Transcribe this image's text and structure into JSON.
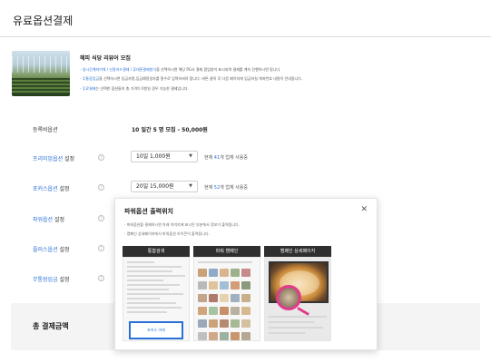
{
  "page": {
    "title": "유료옵션결제"
  },
  "banner": {
    "heading": "헤피 식당 리뷰어 모집",
    "notes": [
      {
        "highlight": "- 실시간계좌이체 / 신용카드결제 / 휴대폰결제방식",
        "text": "을 선택하시면 해당 PG사 결제 팝업창이 표시되며 결제를 계속 진행하시면 됩니다."
      },
      {
        "highlight": "- 무통장입금",
        "text": "을 선택하시면 입금자명,입금예정일자를 필수로 입력하셔야 합니다. 버튼 클릭 후 다음 페이지에 입금하실 계좌번호 내용이 안내됩니다."
      },
      {
        "highlight": "- 무료결제",
        "text": "는 선택한 옵션들의 총 가격이 0원일 경우 가능한 결제입니다."
      }
    ]
  },
  "rows": {
    "registration": {
      "label": "등록비옵션",
      "value": "10 일간 5 명 모집 - 50,000원"
    },
    "premium": {
      "label_hl": "프리미엄옵션",
      "label_rest": " 설정",
      "select": "10일 1,000원",
      "usage_pre": "현재 ",
      "usage_count": "41",
      "usage_post": "개 업체 사용중"
    },
    "focus": {
      "label_hl": "포커스옵션",
      "label_rest": " 설정",
      "select": "20일 15,000원",
      "usage_pre": "현재 ",
      "usage_count": "52",
      "usage_post": "개 업체 사용중"
    },
    "power": {
      "label_hl": "파워옵션",
      "label_rest": " 설정"
    },
    "plus": {
      "label_hl": "플러스옵션",
      "label_rest": " 설정"
    },
    "urgent": {
      "label_hl": "무통장입금",
      "label_rest": " 설정"
    }
  },
  "total": {
    "label": "총 결제금액"
  },
  "popup": {
    "title": "파워옵션 출력위치",
    "desc": [
      "- 파워옵션을 결제하시면 아래 이미지에 표시된 부분에서 정보가 출력됩니다.",
      "- 캠페인 상세페이지에서 파워옵션 아이콘이 출력됩니다."
    ],
    "columns": [
      "통합검색",
      "파워 캠페인",
      "캠페인 상세페이지"
    ],
    "search_below": "포커스 아래"
  },
  "colors": {
    "accent": "#2a6fd6",
    "highlight_ring": "#e23a8c",
    "dark_header": "#2f2f2f"
  },
  "icons": {
    "help": "help-circle-icon",
    "close": "close-icon",
    "caret": "caret-down-icon"
  }
}
